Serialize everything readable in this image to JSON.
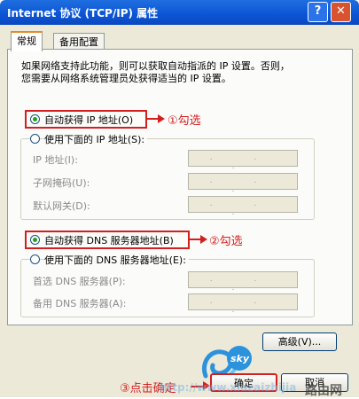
{
  "window": {
    "title": "Internet 协议 (TCP/IP) 属性",
    "help": "?",
    "close": "✕"
  },
  "tabs": [
    "常规",
    "备用配置"
  ],
  "intro": [
    "如果网络支持此功能，则可以获取自动指派的 IP 设置。否则，",
    "您需要从网络系统管理员处获得适当的 IP 设置。"
  ],
  "ip": {
    "auto_label": "自动获得 IP 地址(O)",
    "manual_label": "使用下面的 IP 地址(S):",
    "fields": [
      {
        "label": "IP 地址(I):",
        "value": ". . ."
      },
      {
        "label": "子网掩码(U):",
        "value": ". . ."
      },
      {
        "label": "默认网关(D):",
        "value": ". . ."
      }
    ]
  },
  "dns": {
    "auto_label": "自动获得 DNS 服务器地址(B)",
    "manual_label": "使用下面的 DNS 服务器地址(E):",
    "fields": [
      {
        "label": "首选 DNS 服务器(P):",
        "value": ". . ."
      },
      {
        "label": "备用 DNS 服务器(A):",
        "value": ". . ."
      }
    ]
  },
  "buttons": {
    "advanced": "高级(V)...",
    "ok": "确定",
    "cancel": "取消"
  },
  "annotations": {
    "a1": "①勾选",
    "a2": "②勾选",
    "a3": "③点击确定"
  },
  "watermark": {
    "logo": "sky",
    "url": "http://www.xiazaizhijia",
    "brand": "路由网"
  },
  "colors": {
    "annotation": "#d21f1f",
    "titlebar": "#0c54d4",
    "radio_selected": "#21a121"
  }
}
